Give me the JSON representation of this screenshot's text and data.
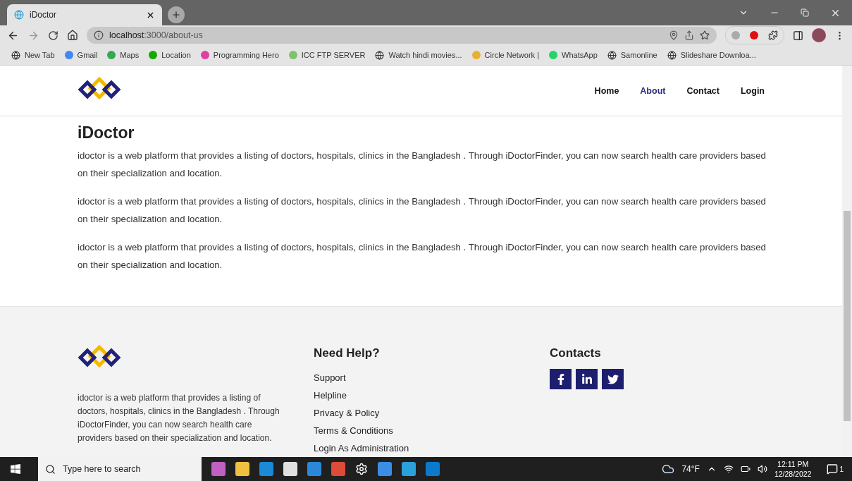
{
  "browser": {
    "tab_title": "iDoctor",
    "url_host": "localhost",
    "url_path": ":3000/about-us",
    "bookmarks": [
      {
        "label": "New Tab",
        "kind": "globe"
      },
      {
        "label": "Gmail",
        "kind": "site",
        "color": "#4285f4"
      },
      {
        "label": "Maps",
        "kind": "site",
        "color": "#34a853"
      },
      {
        "label": "Location",
        "kind": "site",
        "color": "#14a800"
      },
      {
        "label": "Programming Hero",
        "kind": "site",
        "color": "#e040a0"
      },
      {
        "label": "ICC FTP SERVER",
        "kind": "site",
        "color": "#7cc36e"
      },
      {
        "label": "Watch hindi movies...",
        "kind": "globe"
      },
      {
        "label": "Circle Network |",
        "kind": "site",
        "color": "#e8b030"
      },
      {
        "label": "WhatsApp",
        "kind": "site",
        "color": "#25d366"
      },
      {
        "label": "Samonline",
        "kind": "globe"
      },
      {
        "label": "Slideshare Downloa...",
        "kind": "globe"
      }
    ]
  },
  "nav": [
    {
      "label": "Home",
      "selected": false
    },
    {
      "label": "About",
      "selected": true
    },
    {
      "label": "Contact",
      "selected": false
    },
    {
      "label": "Login",
      "selected": false
    }
  ],
  "about": {
    "title": "iDoctor",
    "paragraphs": [
      "idoctor is a web platform that provides a listing of doctors, hospitals, clinics in the Bangladesh . Through iDoctorFinder, you can now search health care providers based on their specialization and location.",
      "idoctor is a web platform that provides a listing of doctors, hospitals, clinics in the Bangladesh . Through iDoctorFinder, you can now search health care providers based on their specialization and location.",
      "idoctor is a web platform that provides a listing of doctors, hospitals, clinics in the Bangladesh . Through iDoctorFinder, you can now search health care providers based on their specialization and location."
    ]
  },
  "footer": {
    "description": "idoctor is a web platform that provides a listing of doctors, hospitals, clinics in the Bangladesh . Through iDoctorFinder, you can now search health care providers based on their specialization and location.",
    "help_title": "Need Help?",
    "links": [
      "Support",
      "Helpline",
      "Privacy & Policy",
      "Terms & Conditions",
      "Login As Administration"
    ],
    "contacts_title": "Contacts",
    "socials": [
      {
        "kind": "facebook"
      },
      {
        "kind": "linkedin"
      },
      {
        "kind": "twitter"
      }
    ]
  },
  "taskbar": {
    "search_placeholder": "Type here to search",
    "weather": "74°F",
    "time": "12:11 PM",
    "date": "12/28/2022",
    "notifications": "1"
  }
}
